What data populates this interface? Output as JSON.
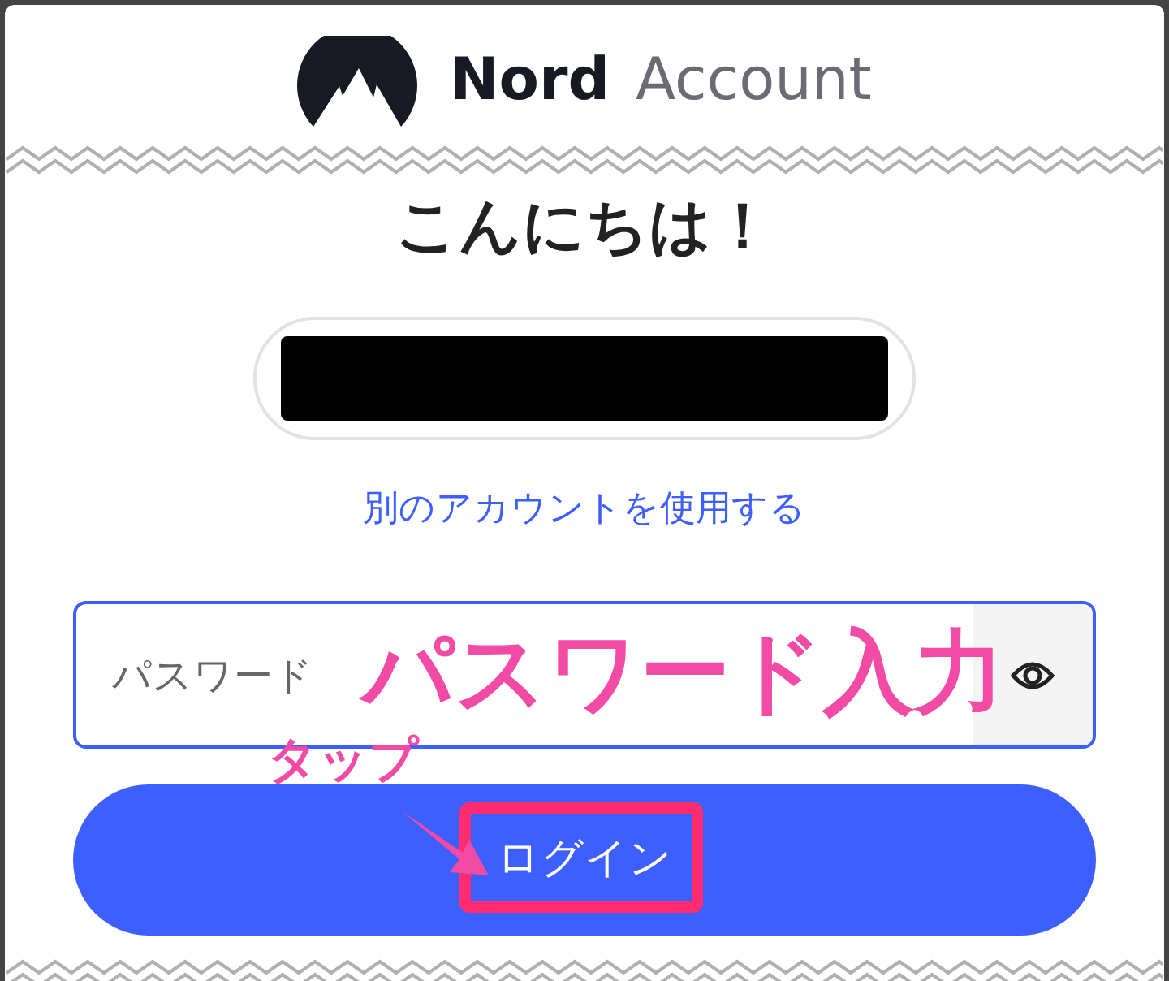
{
  "header": {
    "brand": "Nord",
    "product": "Account"
  },
  "greeting": "こんにちは！",
  "switch_account_link": "別のアカウントを使用する",
  "password_field": {
    "placeholder": "パスワード"
  },
  "annotations": {
    "field_label": "パスワード入力",
    "tap_label": "タップ"
  },
  "login_button": {
    "label": "ログイン"
  }
}
